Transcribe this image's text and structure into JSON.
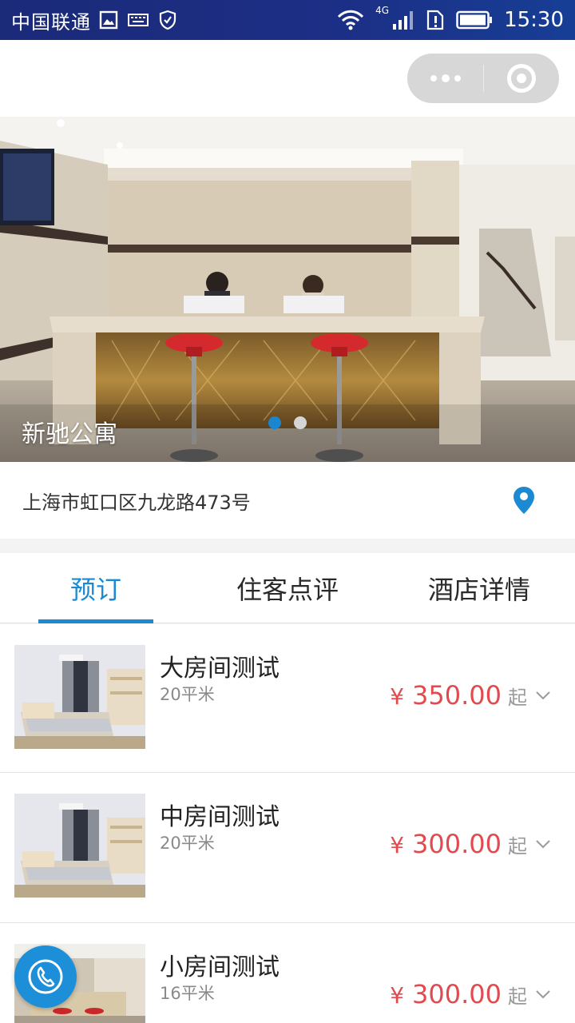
{
  "status_bar": {
    "carrier": "中国联通",
    "network": "4G",
    "time": "15:30"
  },
  "banner": {
    "title": "新驰公寓",
    "slide_count": 2,
    "active_slide": 1
  },
  "address": {
    "text": "上海市虹口区九龙路473号",
    "icon": "location-pin-icon"
  },
  "tabs": [
    {
      "label": "预订",
      "active": true
    },
    {
      "label": "住客点评",
      "active": false
    },
    {
      "label": "酒店详情",
      "active": false
    }
  ],
  "rooms": [
    {
      "name": "大房间测试",
      "size": "20平米",
      "currency": "¥",
      "price": "350.00",
      "suffix": "起"
    },
    {
      "name": "中房间测试",
      "size": "20平米",
      "currency": "¥",
      "price": "300.00",
      "suffix": "起"
    },
    {
      "name": "小房间测试",
      "size": "16平米",
      "currency": "¥",
      "price": "300.00",
      "suffix": "起"
    }
  ],
  "colors": {
    "accent": "#1b8ad3",
    "price": "#e14a4e",
    "status_bar": "#1c2f86"
  }
}
